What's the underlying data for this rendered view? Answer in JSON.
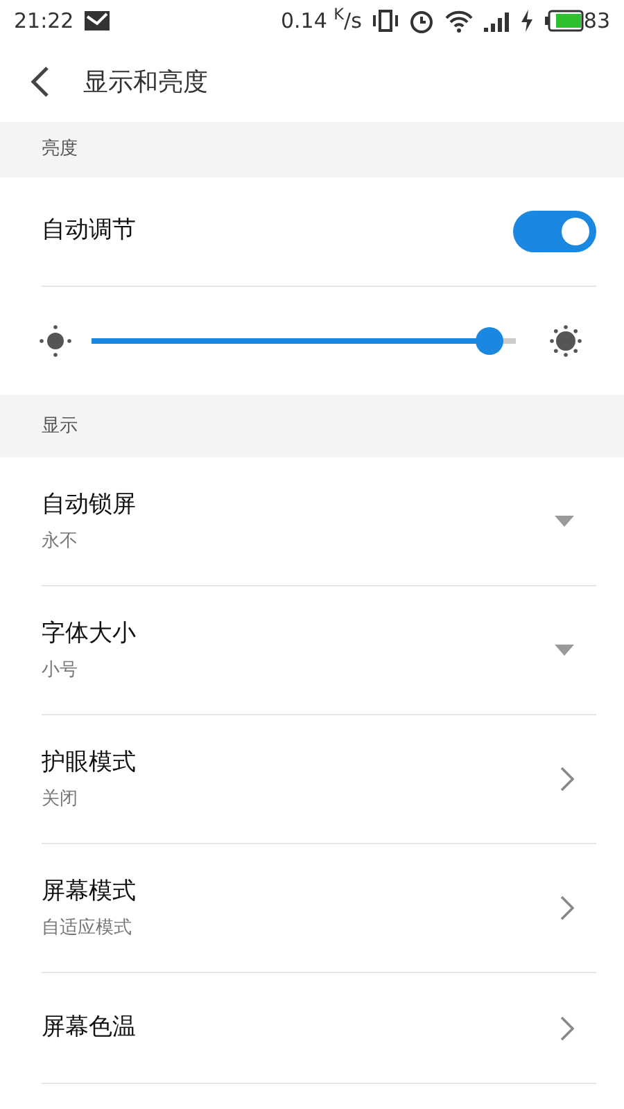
{
  "status_bar": {
    "time": "21:22",
    "speed": "0.14 $^{K}$/s",
    "battery": "83"
  },
  "header": {
    "title": "显示和亮度"
  },
  "sections": [
    {
      "title": "亮度",
      "items": [
        {
          "kind": "toggle",
          "label": "自动调节",
          "on": true
        },
        {
          "kind": "slider",
          "level": 0.97
        }
      ]
    },
    {
      "title": "显示",
      "items": [
        {
          "kind": "dropdown",
          "label": "自动锁屏",
          "value": "永不"
        },
        {
          "kind": "dropdown",
          "label": "字体大小",
          "value": "小号"
        },
        {
          "kind": "link",
          "label": "护眼模式",
          "value": "关闭"
        },
        {
          "kind": "link",
          "label": "屏幕模式",
          "value": "自适应模式"
        },
        {
          "kind": "link",
          "label": "屏幕色温"
        }
      ]
    }
  ]
}
